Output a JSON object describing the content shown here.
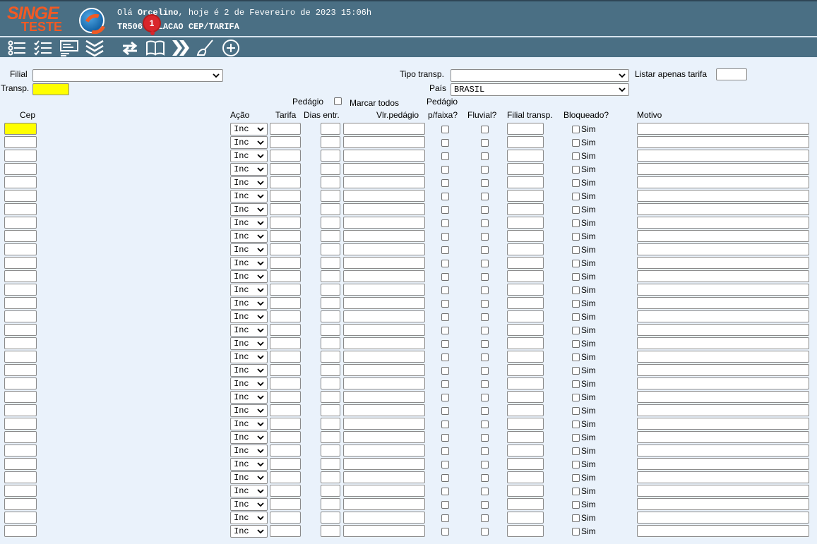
{
  "header": {
    "logo_top": "SINGE",
    "logo_bottom": "TESTE",
    "greeting_prefix": "Olá ",
    "user": "Orcelino",
    "greeting_suffix": ", hoje é 2 de Fevereiro de 2023 15:06h",
    "screen_code": "TR506",
    "screen_title": " RELACAO CEP/TARIFA"
  },
  "toolbar": {
    "icons": [
      "list-icon",
      "checklist-icon",
      "form-icon",
      "chevrons-down-icon",
      "refresh-icon",
      "book-icon",
      "fast-forward-icon",
      "broom-icon",
      "add-circle-icon"
    ],
    "badge": "1"
  },
  "filters": {
    "filial_label": "Filial",
    "filial_value": "",
    "transp_label": "Transp.",
    "transp_value": "",
    "tipo_transp_label": "Tipo transp.",
    "tipo_transp_value": "",
    "listar_label": "Listar apenas tarifa",
    "listar_value": "",
    "pais_label": "País",
    "pais_value": "BRASIL",
    "pedagio_label": "Pedágio",
    "marcar_todos_label": "Marcar todos"
  },
  "columns": {
    "cep": "Cep",
    "acao": "Ação",
    "tarifa": "Tarifa",
    "dias": "Dias entr.",
    "vlr": "Vlr.pedágio",
    "pedagio_top": "Pedágio",
    "pedagio_bottom": "p/faixa?",
    "fluvial": "Fluvial?",
    "filial": "Filial transp.",
    "bloqueado": "Bloqueado?",
    "motivo": "Motivo"
  },
  "rows": {
    "count": 31,
    "acao_value": "Inc",
    "sim_label": "Sim"
  },
  "colors": {
    "header_bg": "#4a6f84",
    "page_bg": "#eaf2fb",
    "required_field": "#ffff00",
    "logo": "#f15a24"
  }
}
